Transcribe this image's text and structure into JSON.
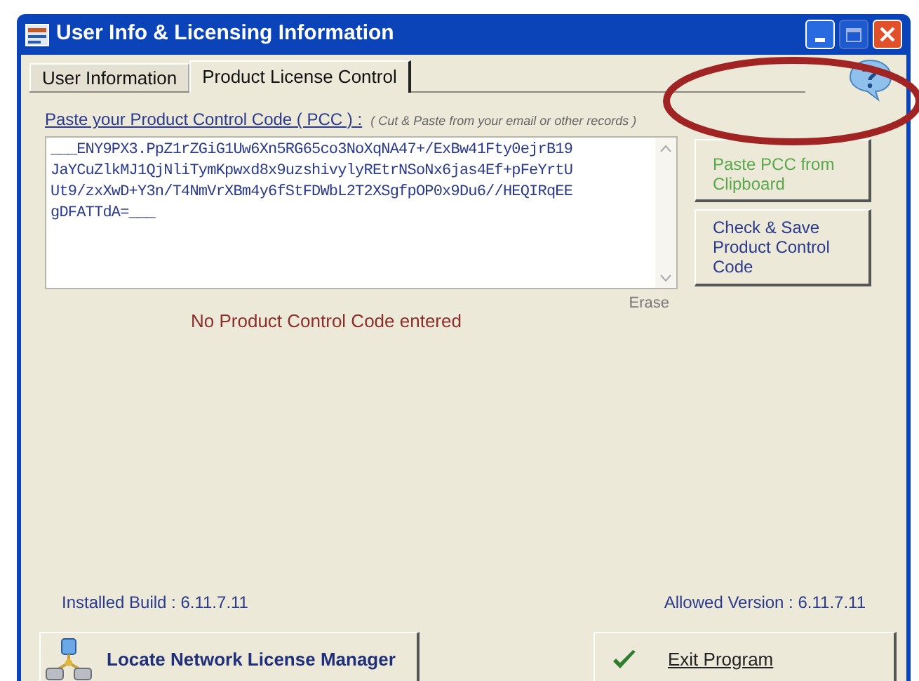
{
  "window": {
    "title": "User Info & Licensing Information"
  },
  "tabs": [
    {
      "label": "User Information",
      "selected": false
    },
    {
      "label": "Product License Control",
      "selected": true
    }
  ],
  "pcc": {
    "label": "Paste your Product Control Code ( PCC ) :",
    "hint": "( Cut & Paste from your email or other records )",
    "lines": [
      "___ENY9PX3.PpZ1rZGiG1Uw6Xn5RG65co3NoXqNA47+/ExBw41Fty0ejrB19",
      "JaYCuZlkMJ1QjNliTymKpwxd8x9uzshivylyREtrNSoNx6jas4Ef+pFeYrtU",
      "Ut9/zxXwD+Y3n/T4NmVrXBm4y6fStFDWbL2T2XSgfpOP0x9Du6//HEQIRqEE",
      "gDFATTdA=___"
    ]
  },
  "side_buttons": [
    {
      "label": "Paste PCC from Clipboard",
      "disabled": true
    },
    {
      "label": "Check & Save Product Control Code",
      "disabled": false
    }
  ],
  "erase": "Erase",
  "status_message": "No Product Control Code entered",
  "installed_build": "Installed Build : 6.11.7.11",
  "allowed_version": "Allowed Version : 6.11.7.11",
  "bottom_buttons": [
    {
      "label": "Locate Network License Manager",
      "kind": "network"
    },
    {
      "label": "Exit Program",
      "kind": "exit"
    }
  ]
}
